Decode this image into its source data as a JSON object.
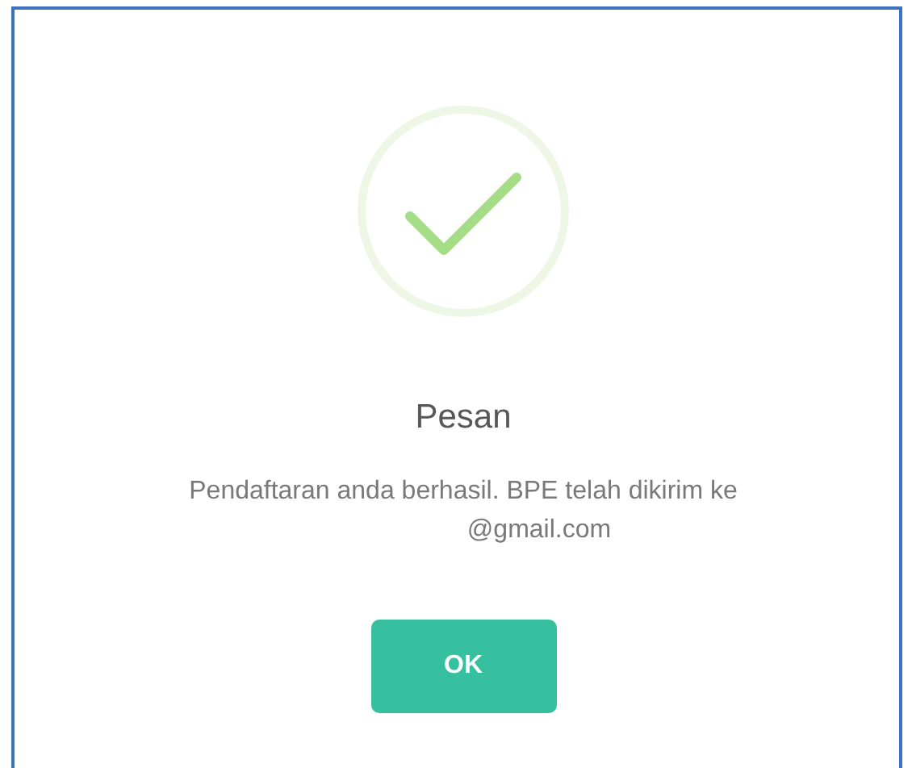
{
  "dialog": {
    "icon": {
      "kind": "success"
    },
    "title": "Pesan",
    "message_lines": [
      "Pendaftaran anda berhasil. BPE telah dikirim ke",
      "@gmail.com"
    ],
    "buttons": [
      {
        "label": "OK"
      }
    ]
  }
}
